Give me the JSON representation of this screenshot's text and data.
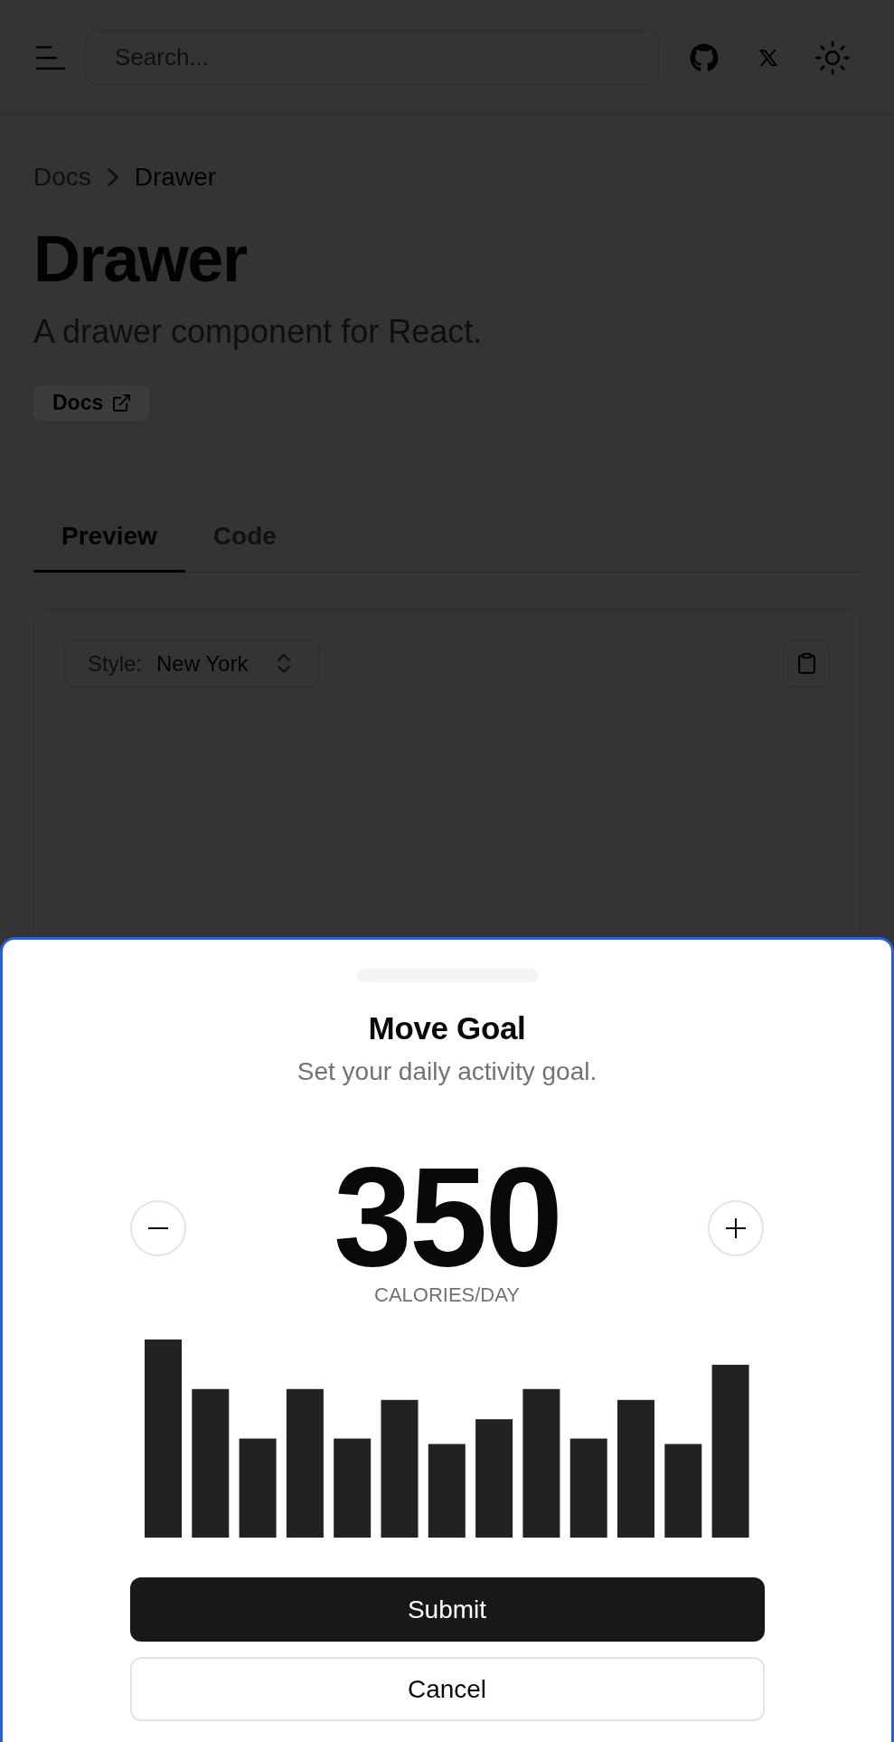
{
  "header": {
    "search": {
      "placeholder": "Search..."
    }
  },
  "breadcrumb": [
    {
      "label": "Docs",
      "current": false
    },
    {
      "label": "Drawer",
      "current": true
    }
  ],
  "page": {
    "title": "Drawer",
    "description": "A drawer component for React.",
    "docs_link": "Docs"
  },
  "tabs": [
    {
      "label": "Preview",
      "selected": true
    },
    {
      "label": "Code",
      "selected": false
    }
  ],
  "preview": {
    "style_select": {
      "label": "Style:",
      "value": "New York"
    }
  },
  "drawer": {
    "title": "Move Goal",
    "description": "Set your daily activity goal.",
    "goal": "350",
    "unit": "CALORIES/DAY",
    "buttons": [
      {
        "label": "Submit",
        "kind": "primary"
      },
      {
        "label": "Cancel",
        "kind": "outline"
      }
    ]
  }
}
